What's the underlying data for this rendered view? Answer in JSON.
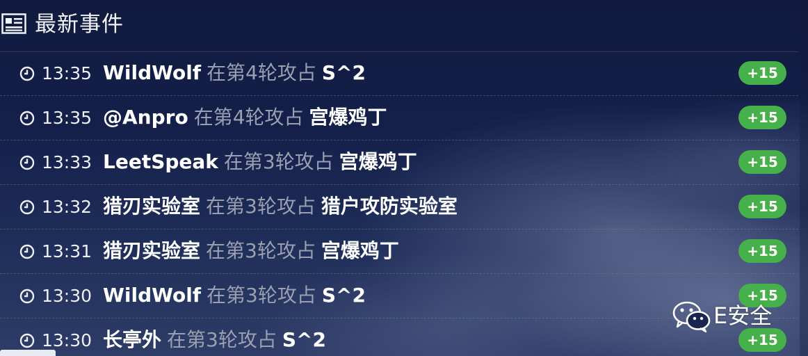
{
  "header": {
    "title": "最新事件",
    "icon": "newspaper-icon"
  },
  "events": [
    {
      "time": "13:35",
      "attacker": "WildWolf",
      "action": "在第4轮攻占",
      "target": "S^2",
      "score": "+15"
    },
    {
      "time": "13:35",
      "attacker": "@Anpro",
      "action": "在第4轮攻占",
      "target": "宫爆鸡丁",
      "score": "+15"
    },
    {
      "time": "13:33",
      "attacker": "LeetSpeak",
      "action": "在第3轮攻占",
      "target": "宫爆鸡丁",
      "score": "+15"
    },
    {
      "time": "13:32",
      "attacker": "猎刃实验室",
      "action": "在第3轮攻占",
      "target": "猎户攻防实验室",
      "score": "+15"
    },
    {
      "time": "13:31",
      "attacker": "猎刃实验室",
      "action": "在第3轮攻占",
      "target": "宫爆鸡丁",
      "score": "+15"
    },
    {
      "time": "13:30",
      "attacker": "WildWolf",
      "action": "在第3轮攻占",
      "target": "S^2",
      "score": "+15"
    },
    {
      "time": "13:30",
      "attacker": "长亭外",
      "action": "在第3轮攻占",
      "target": "S^2",
      "score": "+15"
    }
  ],
  "watermark": {
    "text": "E安全",
    "icon": "wechat-icon"
  },
  "colors": {
    "badge": "#46b04a",
    "action_text": "#9aa0b0",
    "background": "#14204a"
  }
}
